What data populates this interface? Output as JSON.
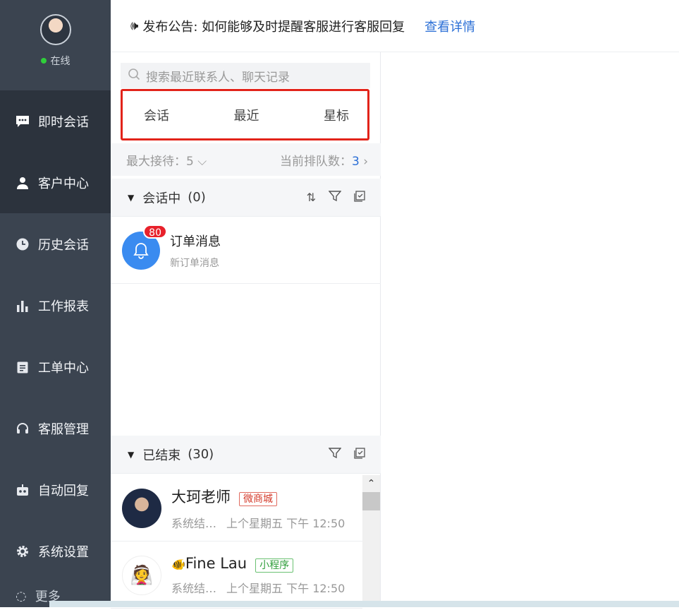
{
  "sidebar": {
    "status": "在线",
    "items": [
      {
        "label": "即时会话",
        "icon": "chat-icon"
      },
      {
        "label": "客户中心",
        "icon": "user-icon"
      },
      {
        "label": "历史会话",
        "icon": "clock-icon"
      },
      {
        "label": "工作报表",
        "icon": "bar-chart-icon"
      },
      {
        "label": "工单中心",
        "icon": "clipboard-icon"
      },
      {
        "label": "客服管理",
        "icon": "headset-icon"
      },
      {
        "label": "自动回复",
        "icon": "robot-icon"
      },
      {
        "label": "系统设置",
        "icon": "gear-icon"
      }
    ],
    "more": "更多"
  },
  "announcement": {
    "text": "发布公告: 如何能够及时提醒客服进行客服回复",
    "link": "查看详情"
  },
  "search": {
    "placeholder": "搜索最近联系人、聊天记录"
  },
  "tabs": [
    "会话",
    "最近",
    "星标"
  ],
  "queue": {
    "max_label": "最大接待：5",
    "queue_label": "当前排队数：",
    "queue_count": "3"
  },
  "sections": {
    "active": {
      "label": "会话中",
      "count": "(0)"
    },
    "ended": {
      "label": "已结束",
      "count": "(30)"
    }
  },
  "order_message": {
    "title": "订单消息",
    "subtitle": "新订单消息",
    "badge": "80"
  },
  "ended_conversations": [
    {
      "name": "大珂老师",
      "tag": "微商城",
      "preview": "系统结…",
      "time": "上个星期五 下午 12:50"
    },
    {
      "name": "Fine Lau",
      "tag": "小程序",
      "preview": "系统结…",
      "time": "上个星期五 下午 12:50"
    }
  ],
  "colors": {
    "sidebar": "#3b4450",
    "accent": "#2b6fd6",
    "highlight_border": "#e2231a",
    "badge": "#e8212b"
  }
}
